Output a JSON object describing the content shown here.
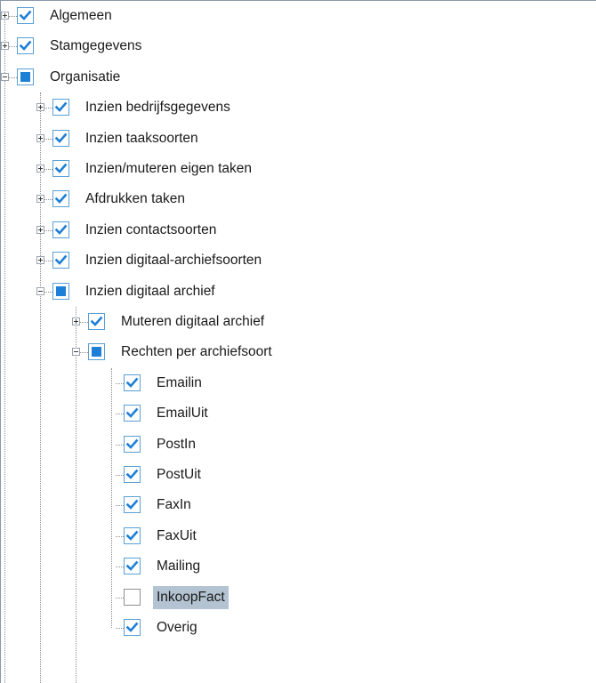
{
  "tree": {
    "items": [
      {
        "label": "Algemeen",
        "level": 0,
        "expander": "plus",
        "check": "checked"
      },
      {
        "label": "Stamgegevens",
        "level": 0,
        "expander": "plus",
        "check": "checked"
      },
      {
        "label": "Organisatie",
        "level": 0,
        "expander": "minus",
        "check": "partial"
      },
      {
        "label": "Inzien bedrijfsgegevens",
        "level": 1,
        "expander": "plus",
        "check": "checked"
      },
      {
        "label": "Inzien taaksoorten",
        "level": 1,
        "expander": "plus",
        "check": "checked"
      },
      {
        "label": "Inzien/muteren eigen taken",
        "level": 1,
        "expander": "plus",
        "check": "checked"
      },
      {
        "label": "Afdrukken taken",
        "level": 1,
        "expander": "plus",
        "check": "checked"
      },
      {
        "label": "Inzien contactsoorten",
        "level": 1,
        "expander": "plus",
        "check": "checked"
      },
      {
        "label": "Inzien digitaal-archiefsoorten",
        "level": 1,
        "expander": "plus",
        "check": "checked"
      },
      {
        "label": "Inzien digitaal archief",
        "level": 1,
        "expander": "minus",
        "check": "partial"
      },
      {
        "label": "Muteren digitaal archief",
        "level": 2,
        "expander": "plus",
        "check": "checked"
      },
      {
        "label": "Rechten per archiefsoort",
        "level": 2,
        "expander": "minus",
        "check": "partial"
      },
      {
        "label": "Emailin",
        "level": 3,
        "expander": "none",
        "check": "checked"
      },
      {
        "label": "EmailUit",
        "level": 3,
        "expander": "none",
        "check": "checked"
      },
      {
        "label": "PostIn",
        "level": 3,
        "expander": "none",
        "check": "checked"
      },
      {
        "label": "PostUit",
        "level": 3,
        "expander": "none",
        "check": "checked"
      },
      {
        "label": "FaxIn",
        "level": 3,
        "expander": "none",
        "check": "checked"
      },
      {
        "label": "FaxUit",
        "level": 3,
        "expander": "none",
        "check": "checked"
      },
      {
        "label": "Mailing",
        "level": 3,
        "expander": "none",
        "check": "checked"
      },
      {
        "label": "InkoopFact",
        "level": 3,
        "expander": "none",
        "check": "unchecked",
        "selected": true
      },
      {
        "label": "Overig",
        "level": 3,
        "expander": "none",
        "check": "checked"
      }
    ]
  },
  "colors": {
    "checkbox_border": "#5a9fd6",
    "check_mark": "#1e7fd6",
    "selection": "#b3c3d1"
  }
}
